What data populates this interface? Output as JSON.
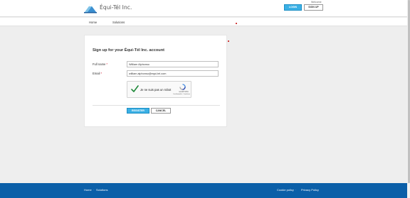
{
  "header": {
    "brand": "Équi-Tél Inc.",
    "welcome": "Welcome",
    "login_label": "LOGIN",
    "signup_label": "SIGN UP"
  },
  "nav": {
    "items": [
      "Home",
      "Solutions"
    ]
  },
  "form": {
    "title": "Sign up for your Équi-Tél Inc. account",
    "full_name_label": "Full name",
    "full_name_value": "William Alphonso",
    "email_label": "Email",
    "email_value": "william.alphonso@equi-tel.com",
    "required_marker": "*",
    "recaptcha_label": "Je ne suis pas un robot",
    "recaptcha_brand": "reCAPTCHA",
    "recaptcha_terms": "Confidentialité - Conditions",
    "register_label": "REGISTER",
    "cancel_label": "CANCEL"
  },
  "footer": {
    "home": "Home",
    "separator": "·",
    "solutions": "Solutions",
    "cookie": "Cookie policy",
    "privacy": "Privacy Policy"
  },
  "colors": {
    "accent": "#3ab0e5",
    "footer_bg": "#0b5fa8",
    "required": "#d0021b",
    "check": "#1f8a3a"
  },
  "icons": {
    "logo": "mountain-logo-icon",
    "check": "checkmark-icon",
    "recaptcha": "recaptcha-logo-icon"
  }
}
